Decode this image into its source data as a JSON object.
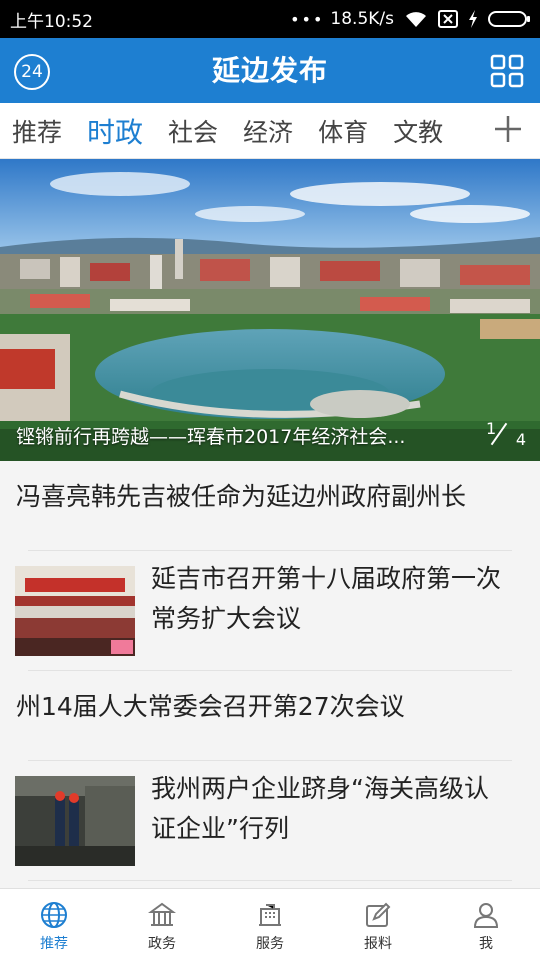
{
  "status_bar": {
    "time": "上午10:52",
    "dots": "•••",
    "speed": "18.5K/s"
  },
  "app_bar": {
    "badge": "24",
    "title": "延边发布"
  },
  "tabs": [
    {
      "label": "推荐",
      "active": false
    },
    {
      "label": "时政",
      "active": true
    },
    {
      "label": "社会",
      "active": false
    },
    {
      "label": "经济",
      "active": false
    },
    {
      "label": "体育",
      "active": false
    },
    {
      "label": "文教",
      "active": false
    }
  ],
  "carousel": {
    "caption": "铿锵前行再跨越——珲春市2017年经济社会...",
    "current": "1",
    "total": "4"
  },
  "news": [
    {
      "title": "冯喜亮韩先吉被任命为延边州政府副州长",
      "has_image": false
    },
    {
      "title": "延吉市召开第十八届政府第一次常务扩大会议",
      "has_image": true
    },
    {
      "title": "州14届人大常委会召开第27次会议",
      "has_image": false
    },
    {
      "title": "我州两户企业跻身“海关高级认证企业”行列",
      "has_image": true
    }
  ],
  "bottom_nav": [
    {
      "label": "推荐",
      "icon": "globe-icon",
      "active": true
    },
    {
      "label": "政务",
      "icon": "government-building-icon",
      "active": false
    },
    {
      "label": "服务",
      "icon": "service-building-icon",
      "active": false
    },
    {
      "label": "报料",
      "icon": "edit-report-icon",
      "active": false
    },
    {
      "label": "我",
      "icon": "user-icon",
      "active": false
    }
  ],
  "colors": {
    "primary": "#1e7fd1",
    "statusbar": "#000000",
    "background": "#f4f4f4"
  }
}
